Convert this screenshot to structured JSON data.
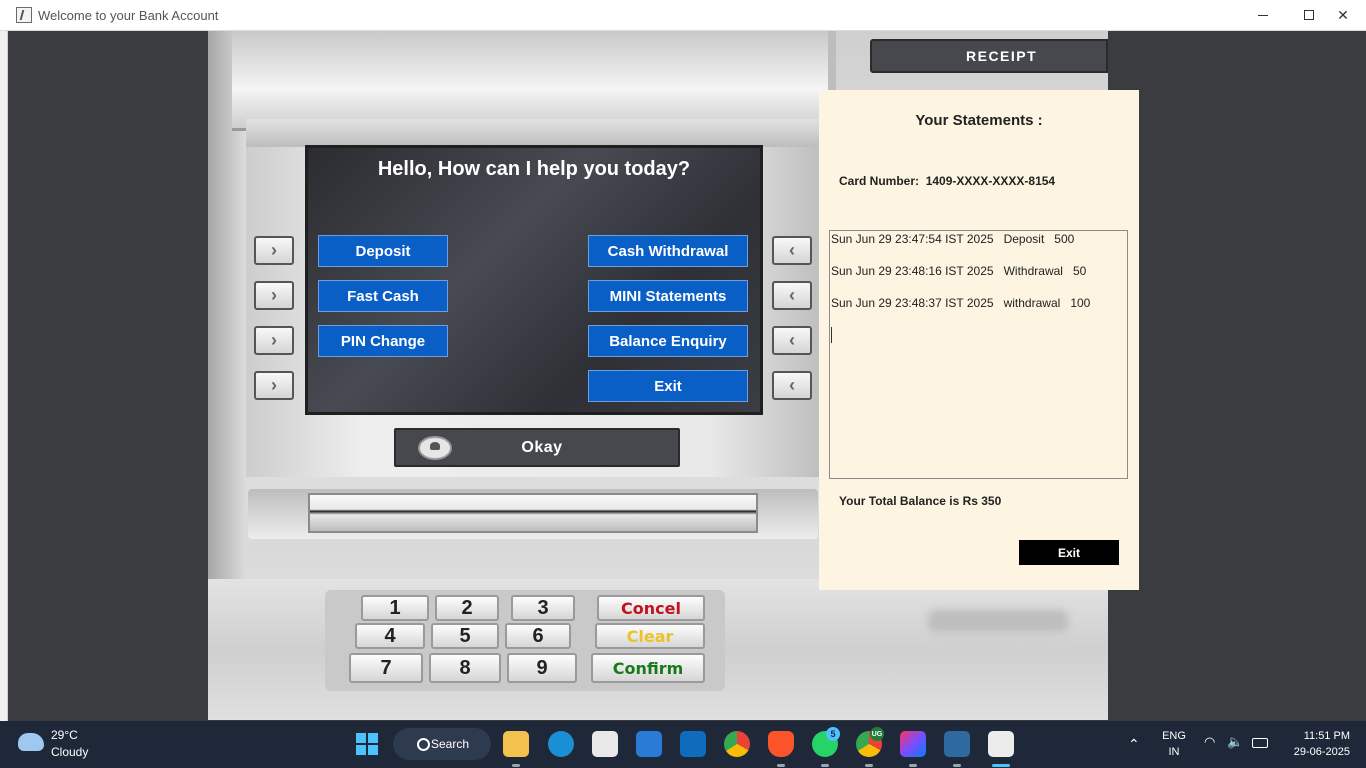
{
  "window": {
    "title": "Welcome to your Bank Account",
    "controls": {
      "minimize": "—",
      "maximize": "☐",
      "close": "✕"
    }
  },
  "atm": {
    "screen_title": "Hello, How can I help you today?",
    "menu_left": [
      "Deposit",
      "Fast Cash",
      "PIN Change"
    ],
    "menu_right": [
      "Cash Withdrawal",
      "MINI Statements",
      "Balance Enquiry",
      "Exit"
    ],
    "side_key_left": "›",
    "side_key_right": "‹",
    "okay_label": "Okay",
    "receipt_label": "RECEIPT",
    "keypad": {
      "digits": [
        "1",
        "2",
        "3",
        "4",
        "5",
        "6",
        "7",
        "8",
        "9"
      ],
      "cancel": "Concel",
      "clear": "Clear",
      "confirm": "Confirm"
    },
    "colors": {
      "button_blue": "#0a5fc7",
      "cancel": "#c0141c",
      "clear": "#e8c32a",
      "confirm": "#1a7a1a"
    }
  },
  "statement": {
    "title": "Your Statements :",
    "card_label": "Card Number:",
    "card_number": "1409-XXXX-XXXX-8154",
    "transactions": [
      {
        "date": "Sun Jun 29 23:47:54 IST 2025",
        "type": "Deposit",
        "amount": "500"
      },
      {
        "date": "Sun Jun 29 23:48:16 IST 2025",
        "type": "Withdrawal",
        "amount": "50"
      },
      {
        "date": "Sun Jun 29 23:48:37 IST 2025",
        "type": "withdrawal",
        "amount": "100"
      }
    ],
    "balance_text": "Your Total Balance is Rs 350",
    "exit_label": "Exit",
    "background": "#fdf5e2"
  },
  "taskbar": {
    "weather_temp": "29°C",
    "weather_desc": "Cloudy",
    "search_label": "Search",
    "apps": [
      "start-icon",
      "file-explorer-icon",
      "edge-icon",
      "store-icon",
      "mail-icon",
      "outlook-icon",
      "chrome-icon",
      "brave-icon",
      "whatsapp-icon",
      "chrome-profile-icon",
      "intellij-icon",
      "mysql-workbench-icon",
      "java-icon"
    ],
    "whatsapp_badge": "5",
    "chrome_badge": "UG",
    "language": "ENG",
    "region": "IN",
    "time": "11:51 PM",
    "date": "29-06-2025"
  }
}
